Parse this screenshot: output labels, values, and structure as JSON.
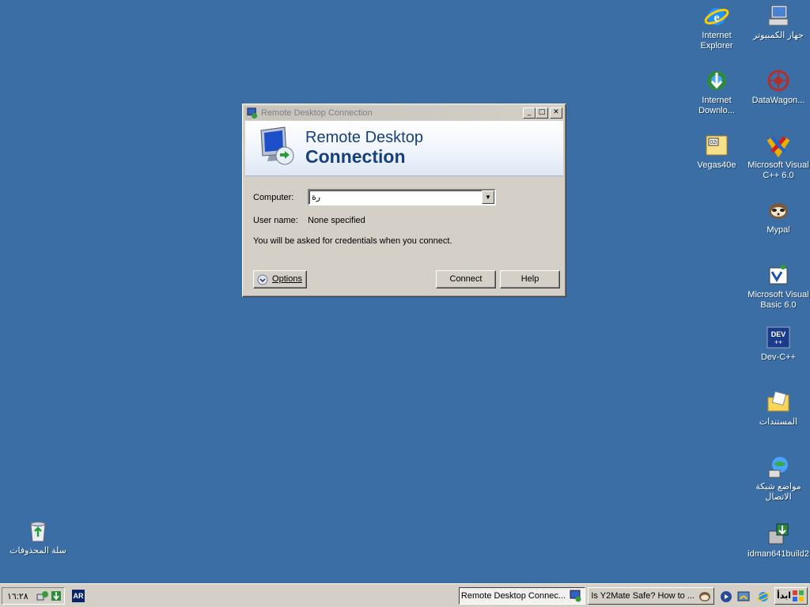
{
  "desktop": {
    "icons": [
      {
        "label": "Internet Explorer",
        "icon": "ie-icon"
      },
      {
        "label": "جهاز الكمبيوتر",
        "icon": "computer-icon"
      },
      {
        "label": "Internet Downlo...",
        "icon": "idm-icon"
      },
      {
        "label": "DataWagon...",
        "icon": "datawagon-icon"
      },
      {
        "label": "Vegas40e",
        "icon": "vegas-icon"
      },
      {
        "label": "Microsoft Visual C++ 6.0",
        "icon": "vcpp-icon"
      },
      {
        "label": "Mypal",
        "icon": "mypal-icon"
      },
      {
        "label": "Microsoft Visual Basic 6.0",
        "icon": "vb-icon"
      },
      {
        "label": "Dev-C++",
        "icon": "devcpp-icon"
      },
      {
        "label": "المستندات",
        "icon": "documents-folder-icon"
      },
      {
        "label": "مواضع شبكة الاتصال",
        "icon": "network-places-icon"
      },
      {
        "label": "idman641build2",
        "icon": "idm-installer-icon"
      },
      {
        "label": "سلة المحذوفات",
        "icon": "recycle-bin-icon"
      }
    ]
  },
  "dialog": {
    "title": "Remote Desktop Connection",
    "banner_line1": "Remote Desktop",
    "banner_line2": "Connection",
    "computer_label": "Computer:",
    "computer_value": "رة",
    "username_label": "User name:",
    "username_value": "None specified",
    "credentials_note": "You will be asked for credentials when you connect.",
    "options_label": "Options",
    "connect_label": "Connect",
    "help_label": "Help",
    "minimize": "_",
    "maximize": "□",
    "close": "✕"
  },
  "taskbar": {
    "clock": "١٦:٢٨",
    "language": "AR",
    "tasks": [
      {
        "label": "Remote Desktop Connec...",
        "active": true
      },
      {
        "label": "Is Y2Mate Safe? How to ...",
        "active": false
      }
    ],
    "start_label": "ابدأ"
  },
  "colors": {
    "desktop": "#3a6ea5",
    "chrome": "#d4d0c8",
    "banner_text": "#16407a"
  }
}
